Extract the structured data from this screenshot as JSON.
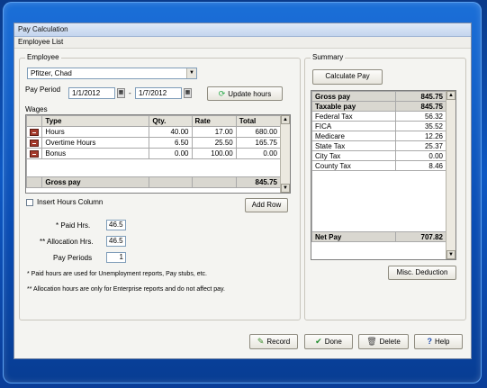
{
  "window": {
    "title": "Pay Calculation"
  },
  "menu": {
    "employee_list": "Employee List"
  },
  "employee": {
    "group_label": "Employee",
    "selected": "Pfitzer, Chad",
    "pay_period_label": "Pay Period",
    "start_date": "1/1/2012",
    "separator": "-",
    "end_date": "1/7/2012",
    "update_hours_label": "Update hours"
  },
  "wages": {
    "group_label": "Wages",
    "columns": [
      "Type",
      "Qty.",
      "Rate",
      "Total"
    ],
    "rows": [
      {
        "type": "Hours",
        "qty": "40.00",
        "rate": "17.00",
        "total": "680.00"
      },
      {
        "type": "Overtime Hours",
        "qty": "6.50",
        "rate": "25.50",
        "total": "165.75"
      },
      {
        "type": "Bonus",
        "qty": "0.00",
        "rate": "100.00",
        "total": "0.00"
      }
    ],
    "gross_label": "Gross pay",
    "gross_value": "845.75",
    "insert_hours_label": "Insert Hours Column",
    "add_row_label": "Add Row"
  },
  "hours": {
    "paid_label": "* Paid Hrs.",
    "paid_value": "46.5",
    "alloc_label": "** Allocation Hrs.",
    "alloc_value": "46.5",
    "periods_label": "Pay Periods",
    "periods_value": "1"
  },
  "notes": {
    "note1": "* Paid hours are used for Unemployment reports, Pay stubs, etc.",
    "note2": "** Allocation hours are only for Enterprise reports and do not affect pay."
  },
  "summary": {
    "group_label": "Summary",
    "calculate_label": "Calculate Pay",
    "gross_label": "Gross pay",
    "gross_value": "845.75",
    "taxable_label": "Taxable pay",
    "taxable_value": "845.75",
    "rows": [
      {
        "name": "Federal Tax",
        "value": "56.32"
      },
      {
        "name": "FICA",
        "value": "35.52"
      },
      {
        "name": "Medicare",
        "value": "12.26"
      },
      {
        "name": "State Tax",
        "value": "25.37"
      },
      {
        "name": "City Tax",
        "value": "0.00"
      },
      {
        "name": "County Tax",
        "value": "8.46"
      }
    ],
    "net_label": "Net Pay",
    "net_value": "707.82",
    "misc_label": "Misc. Deduction"
  },
  "footer": {
    "record_label": "Record",
    "done_label": "Done",
    "delete_label": "Delete",
    "help_label": "Help"
  }
}
